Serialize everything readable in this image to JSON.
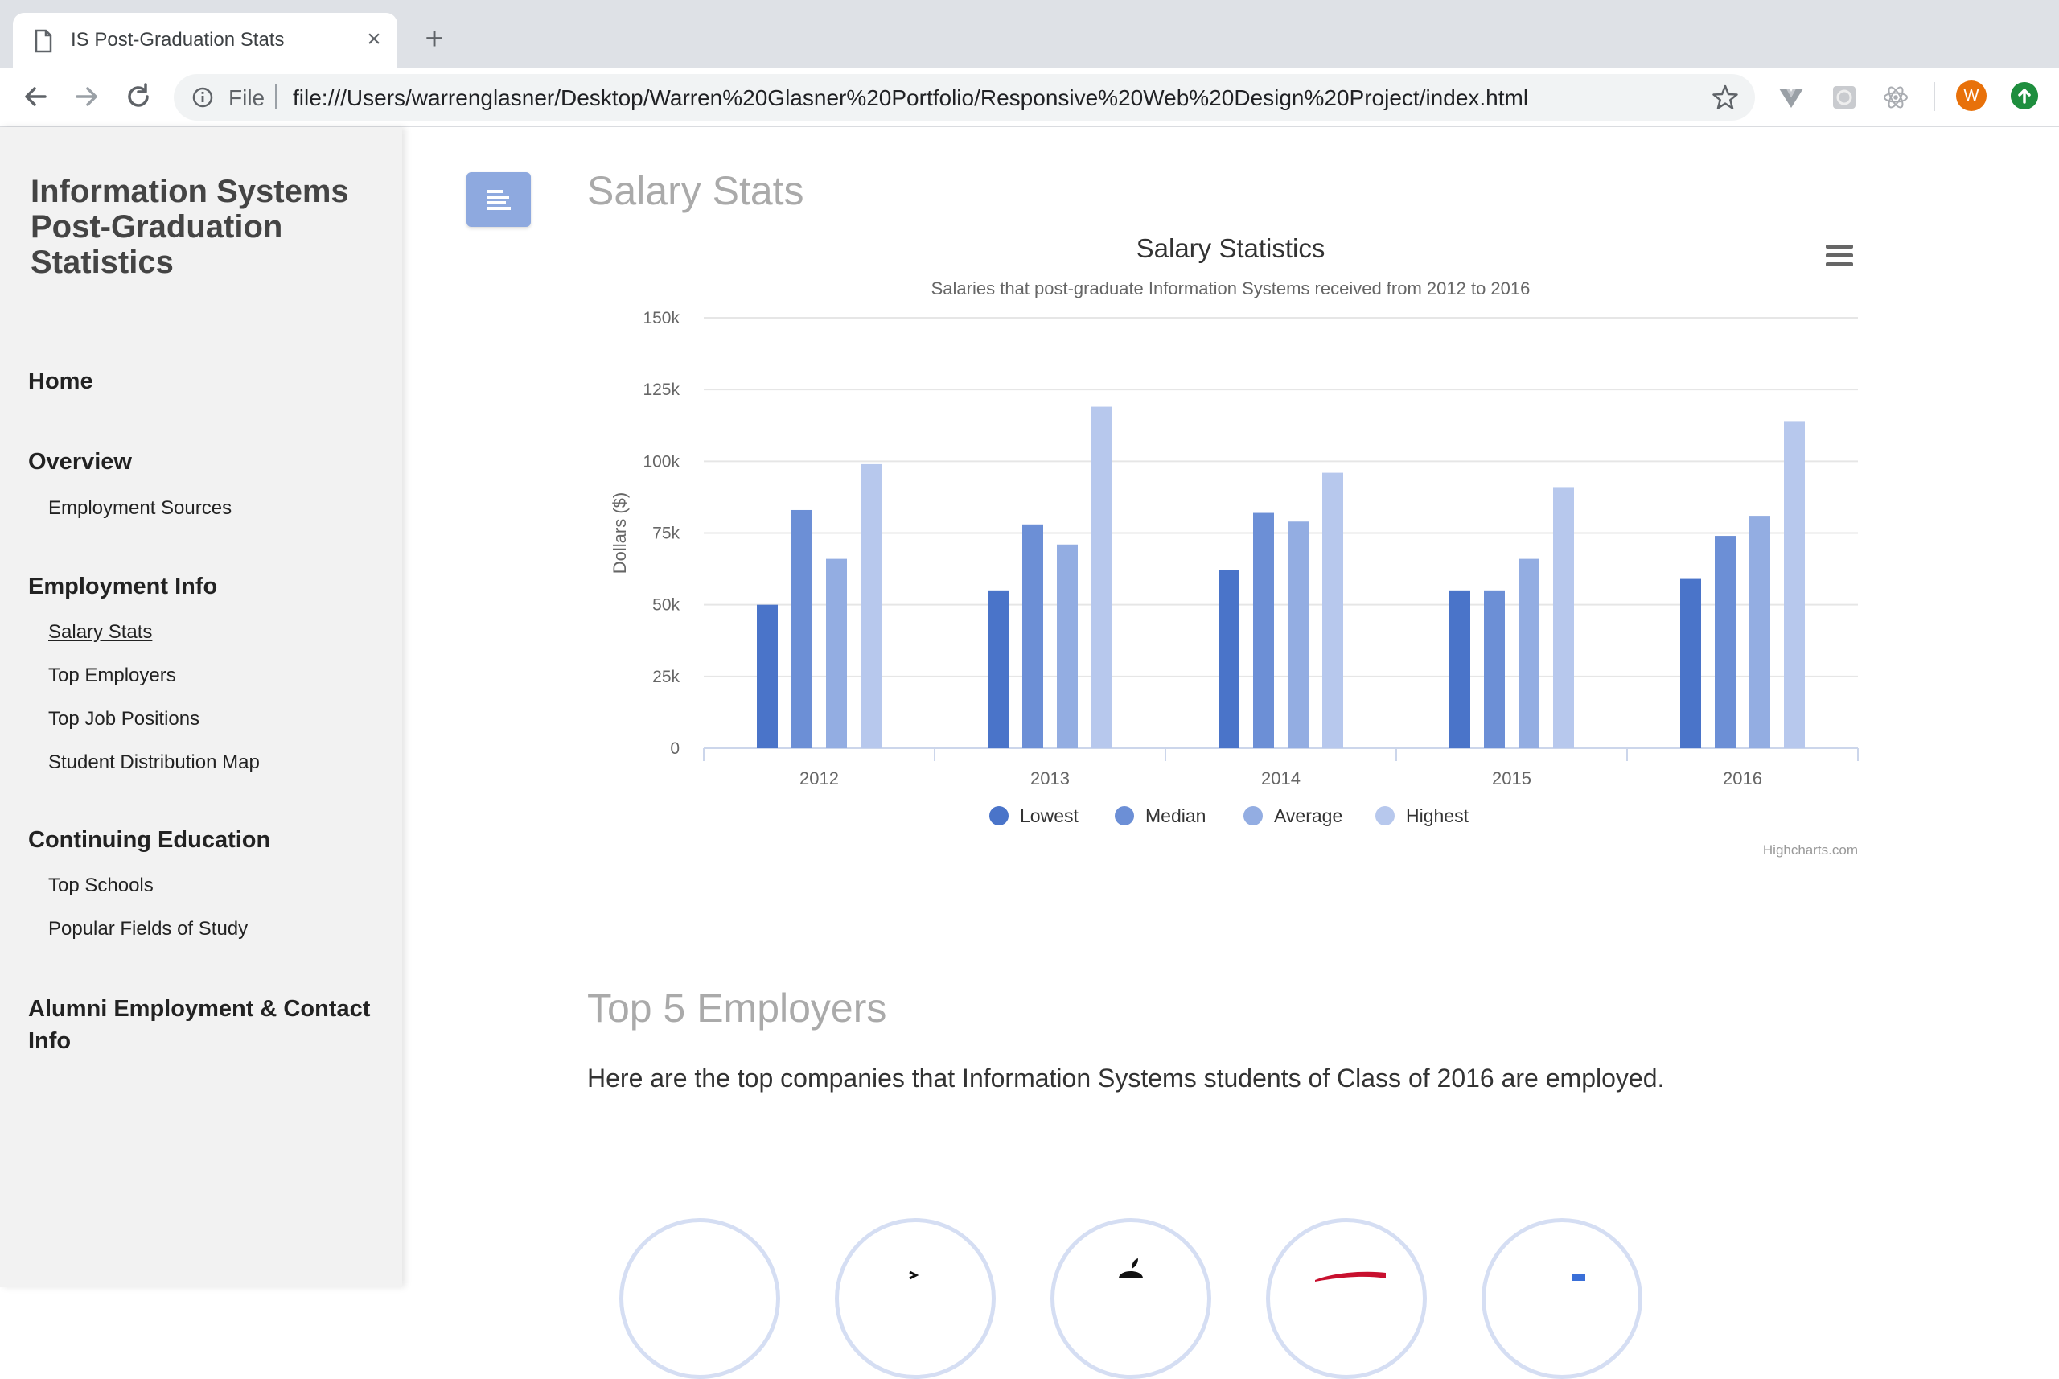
{
  "browser": {
    "tab_title": "IS Post-Graduation Stats",
    "omnibox_scheme": "File",
    "url": "file:///Users/warrenglasner/Desktop/Warren%20Glasner%20Portfolio/Responsive%20Web%20Design%20Project/index.html",
    "avatar_initial": "W"
  },
  "sidebar": {
    "title": "Information Systems Post-Graduation Statistics",
    "home": "Home",
    "overview": "Overview",
    "overview_items": [
      "Employment Sources"
    ],
    "employment": "Employment Info",
    "employment_items": [
      "Salary Stats",
      "Top Employers",
      "Top Job Positions",
      "Student Distribution Map"
    ],
    "continuing": "Continuing Education",
    "continuing_items": [
      "Top Schools",
      "Popular Fields of Study"
    ],
    "alumni": "Alumni Employment & Contact Info"
  },
  "main": {
    "salary_heading": "Salary Stats",
    "employers_heading": "Top 5 Employers",
    "employers_text": "Here are the top companies that Information Systems students of Class of 2016 are employed."
  },
  "chart_data": {
    "type": "bar",
    "title": "Salary Statistics",
    "subtitle": "Salaries that post-graduate Information Systems received from 2012 to 2016",
    "ylabel": "Dollars ($)",
    "xlabel": "",
    "categories": [
      "2012",
      "2013",
      "2014",
      "2015",
      "2016"
    ],
    "ylim": [
      0,
      150000
    ],
    "yticks": [
      0,
      25000,
      50000,
      75000,
      100000,
      125000,
      150000
    ],
    "ytick_labels": [
      "0",
      "25k",
      "50k",
      "75k",
      "100k",
      "125k",
      "150k"
    ],
    "grid": true,
    "legend_position": "bottom-center",
    "series": [
      {
        "name": "Lowest",
        "color": "#4a74c9",
        "values": [
          50000,
          55000,
          62000,
          55000,
          59000
        ]
      },
      {
        "name": "Median",
        "color": "#6c8fd6",
        "values": [
          83000,
          78000,
          82000,
          55000,
          74000
        ]
      },
      {
        "name": "Average",
        "color": "#93ade2",
        "values": [
          66000,
          71000,
          79000,
          66000,
          81000
        ]
      },
      {
        "name": "Highest",
        "color": "#b7c8ed",
        "values": [
          99000,
          119000,
          96000,
          91000,
          114000
        ]
      }
    ],
    "credits": "Highcharts.com"
  }
}
